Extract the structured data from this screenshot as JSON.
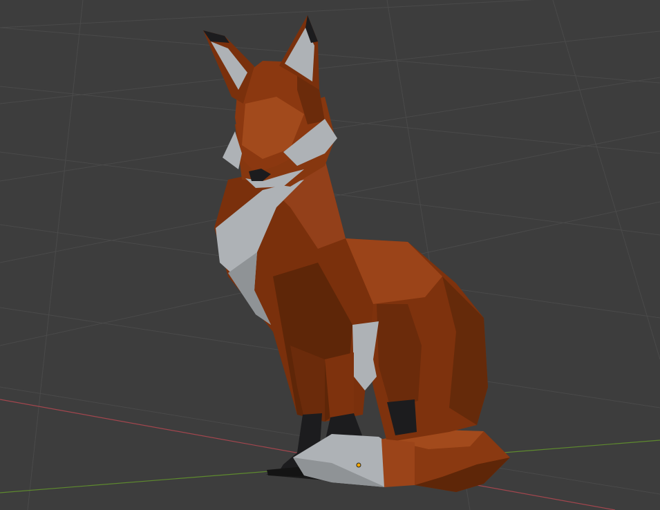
{
  "viewport": {
    "background": "#3d3d3d",
    "grid_color": "#4a4a4a",
    "x_axis_color": "#a3464e",
    "y_axis_color": "#5e8a2e",
    "origin_color": "#f7a800"
  },
  "model": {
    "subject": "low-poly fox",
    "palette": {
      "fur_dark": "#5e2608",
      "fur_mid": "#83350f",
      "fur_light": "#a24a1c",
      "white_fur": "#aeb2b6",
      "white_shade": "#8f9396",
      "paws": "#1c1c1e"
    }
  }
}
